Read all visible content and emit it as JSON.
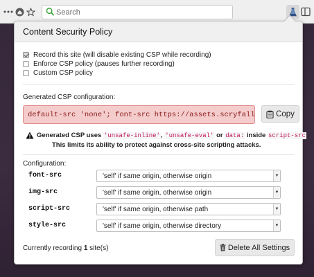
{
  "browser": {
    "search_placeholder": "Search",
    "icons": [
      "more-icon",
      "home-icon",
      "bookmark-star-icon",
      "search-icon",
      "extension-flask-icon",
      "sidebar-icon"
    ]
  },
  "popup": {
    "title": "Content Security Policy",
    "options": [
      {
        "label": "Record this site (will disable existing CSP while recording)",
        "checked": true
      },
      {
        "label": "Enforce CSP policy (pauses further recording)",
        "checked": false
      },
      {
        "label": "Custom CSP policy",
        "checked": false
      }
    ],
    "generated_label": "Generated CSP configuration:",
    "generated_value": "default-src 'none'; font-src https://assets.scryfall.com; …",
    "copy_label": "Copy",
    "warning": {
      "prefix": "Generated CSP uses",
      "term1": "'unsafe-inline'",
      "sep1": ",",
      "term2": "'unsafe-eval'",
      "or_text": "or",
      "term3": "data:",
      "inside_text": "inside",
      "term4": "script-src",
      "end": ".",
      "line2": "This limits its ability to protect against cross-site scripting attacks."
    },
    "configuration_label": "Configuration:",
    "config": [
      {
        "name": "font-src",
        "value": "'self' if same origin, otherwise origin"
      },
      {
        "name": "img-src",
        "value": "'self' if same origin, otherwise origin"
      },
      {
        "name": "script-src",
        "value": "'self' if same origin, otherwise path"
      },
      {
        "name": "style-src",
        "value": "'self' if same origin, otherwise directory"
      }
    ],
    "status": {
      "prefix": "Currently recording",
      "count": "1",
      "suffix": "site(s)"
    },
    "delete_label": "Delete All Settings"
  },
  "colors": {
    "csp_box_bg": "#f4cccc",
    "csp_box_text": "#8b1a1a",
    "keyword": "#c0175d"
  }
}
